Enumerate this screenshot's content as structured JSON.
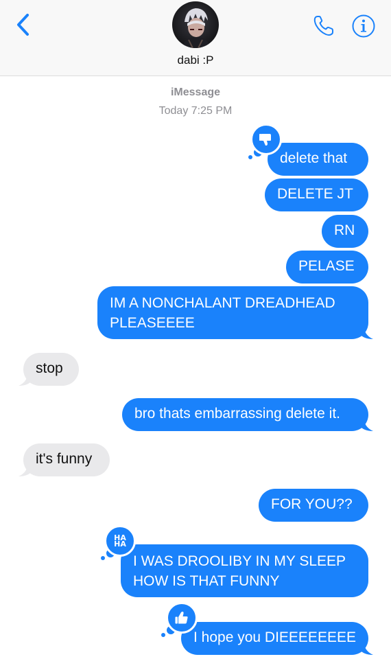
{
  "header": {
    "contact_name": "dabi :P",
    "back_icon": "chevron-left-icon",
    "call_icon": "phone-icon",
    "info_icon": "info-icon"
  },
  "conversation": {
    "service": "iMessage",
    "timestamp": "Today 7:25 PM"
  },
  "messages": [
    {
      "direction": "outgoing",
      "text": "delete that",
      "tapback": "thumbs-down"
    },
    {
      "direction": "outgoing",
      "text": "DELETE JT"
    },
    {
      "direction": "outgoing",
      "text": "RN"
    },
    {
      "direction": "outgoing",
      "text": "PELASE"
    },
    {
      "direction": "outgoing",
      "text": "IM A NONCHALANT DREADHEAD PLEASEEEE"
    },
    {
      "direction": "incoming",
      "text": "stop"
    },
    {
      "direction": "outgoing",
      "text": "bro thats embarrassing delete it."
    },
    {
      "direction": "incoming",
      "text": "it's funny"
    },
    {
      "direction": "outgoing",
      "text": "FOR YOU??"
    },
    {
      "direction": "outgoing",
      "text": "I WAS DROOLIBY IN MY SLEEP HOW IS THAT FUNNY",
      "tapback": "haha"
    },
    {
      "direction": "outgoing",
      "text": "I hope you DIEEEEEEEE",
      "tapback": "thumbs-up"
    }
  ],
  "tapback_labels": {
    "haha_line1": "HA",
    "haha_line2": "HA"
  },
  "colors": {
    "outgoing_bubble": "#1a82fb",
    "incoming_bubble": "#e9e9eb",
    "accent": "#1a82fb",
    "meta_text": "#8e8e93"
  }
}
